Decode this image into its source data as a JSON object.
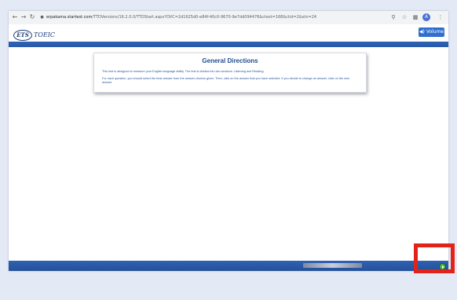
{
  "browser": {
    "url_host": "erpakama.startest.com",
    "url_path": "/TTDVersions/16.2.0.0/TTDStart.aspx?OVC=2d1625d0-e84f-40c0-9670-9e7dd094476&ctest=168&ctid=2&stn=24",
    "icons": [
      "back-arrow-icon",
      "forward-arrow-icon",
      "reload-icon",
      "lock-icon",
      "zoom-icon",
      "star-icon",
      "extensions-icon",
      "profile-avatar",
      "menu-dots-icon"
    ],
    "profile_initial": "A"
  },
  "header": {
    "logo_ets": "ETS",
    "logo_toeic": "TOEIC",
    "volume_label": "Volume"
  },
  "directions": {
    "title": "General Directions",
    "paragraph1": "This test is designed to measure your English language ability. The test is divided into two sections: Listening and Reading.",
    "paragraph2": "For each question, you should select the best answer from the answer choices given. Then, click on the answer that you have selected. If you decide to change an answer, click on the new answer."
  },
  "colors": {
    "band": "#2e63b5",
    "title": "#1f4d8f",
    "next_button": "#47b24a",
    "highlight": "#e2231a",
    "page_bg": "#e4e9f6"
  }
}
